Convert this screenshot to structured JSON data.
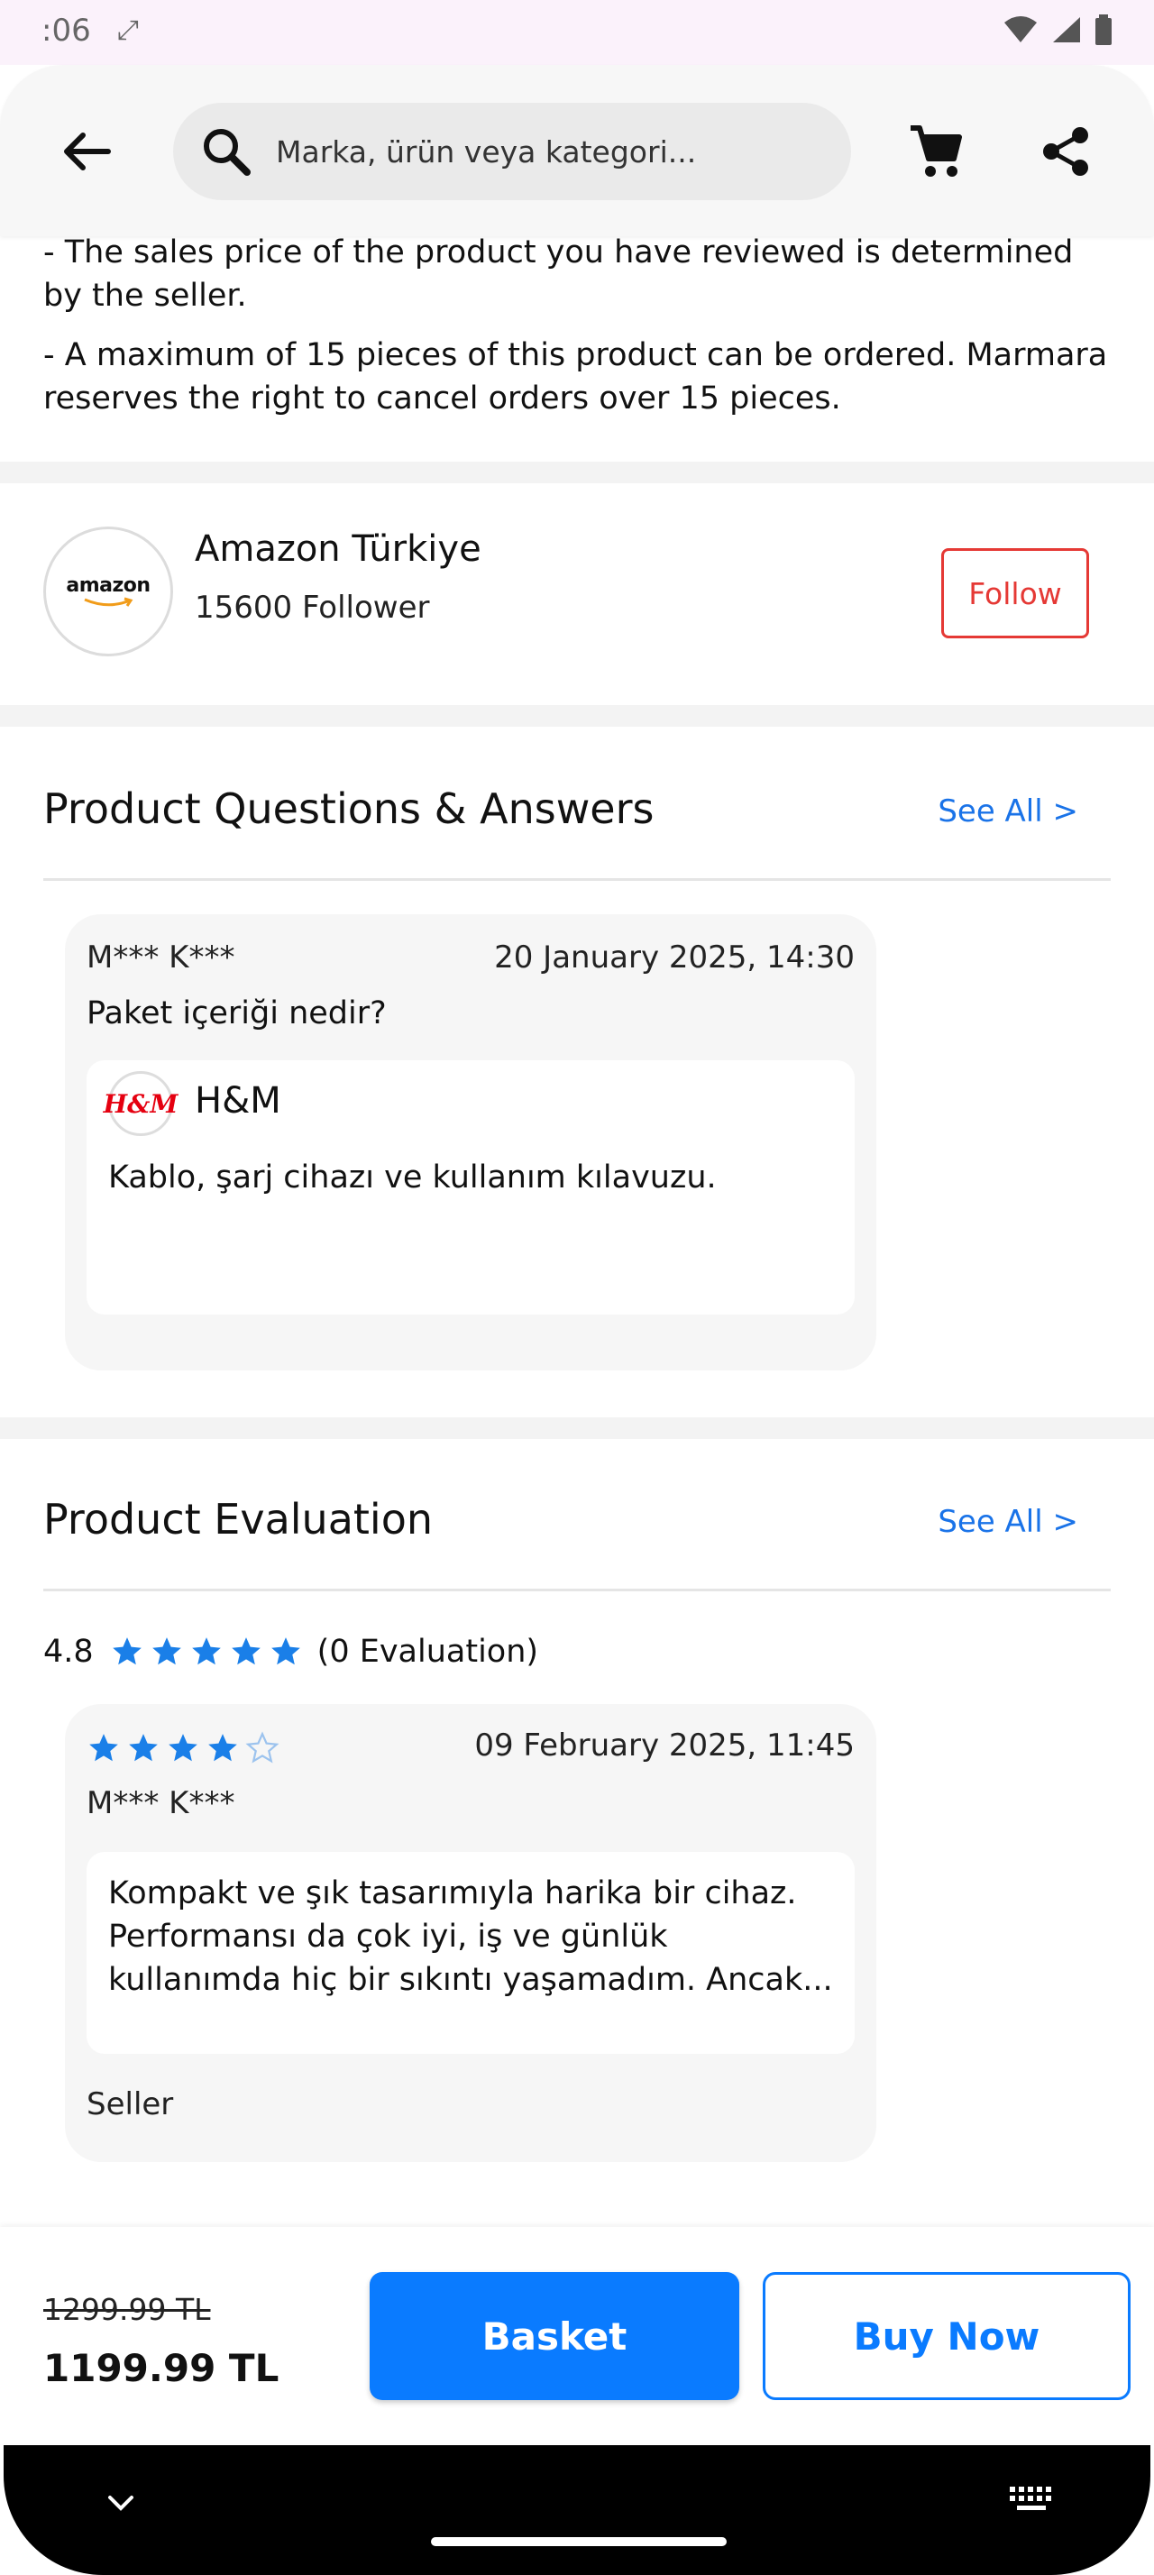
{
  "status_bar": {
    "time": ":06",
    "expand_glyph": "⤢"
  },
  "search": {
    "placeholder": "Marka, ürün veya kategori..."
  },
  "notes": [
    "- The sales price of the product you have reviewed is determined by the seller.",
    "- A maximum of 15 pieces of this product can be ordered. Marmara reserves the right to cancel orders over 15 pieces."
  ],
  "seller": {
    "logo_text": "amazon",
    "name": "Amazon Türkiye",
    "followers": "15600 Follower",
    "follow_label": "Follow"
  },
  "qa": {
    "title": "Product Questions & Answers",
    "see_all": "See All >",
    "items": [
      {
        "user": "M*** K***",
        "date": "20 January 2025, 14:30",
        "question": "Paket içeriği nedir?",
        "answer_brand": "H&M",
        "answer_logo": "H&M",
        "answer": "Kablo, şarj cihazı ve kullanım kılavuzu."
      }
    ]
  },
  "evaluation": {
    "title": "Product Evaluation",
    "see_all": "See All >",
    "average": "4.8",
    "average_stars": 5,
    "count_label": "(0 Evaluation)",
    "reviews": [
      {
        "stars": 4,
        "max_stars": 5,
        "date": "09 February 2025, 11:45",
        "user": "M*** K***",
        "text": "Kompakt ve şık tasarımıyla harika bir cihaz. Performansı da çok iyi, iş ve günlük kullanımda hiç bir sıkıntı yaşamadım. Ancak...",
        "source": "Seller"
      }
    ]
  },
  "price": {
    "old": "1299.99 TL",
    "new": "1199.99 TL",
    "basket_label": "Basket",
    "buy_label": "Buy Now"
  },
  "colors": {
    "accent_blue": "#0a7bff",
    "link_blue": "#1a73e8",
    "star_blue": "#1a7fe8",
    "follow_red": "#e53935",
    "brand_red": "#e50010"
  }
}
